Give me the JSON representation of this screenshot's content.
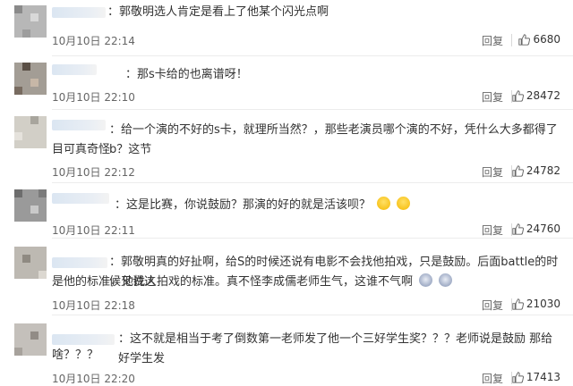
{
  "comments": [
    {
      "text": "郭敬明选人肯定是看上了他某个闪光点啊",
      "time": "10月10日 22:14",
      "reply": "回复",
      "likes": "6680"
    },
    {
      "text": "那s卡给的也离谱呀！",
      "time": "10月10日 22:10",
      "reply": "回复",
      "likes": "28472"
    },
    {
      "text_line1": "给一个演的不好的s卡，就理所当然？，那些老演员哪个演的不好，凭什么大多都得了b？这节",
      "text_line2": "目可真奇怪",
      "time": "10月10日 22:12",
      "reply": "回复",
      "likes": "24782"
    },
    {
      "text": "这是比赛，你说鼓励？那演的好的就是活该呗？",
      "time": "10月10日 22:11",
      "reply": "回复",
      "likes": "24760",
      "emojis": [
        "laughing-tears-emoji",
        "laughing-tears-emoji"
      ]
    },
    {
      "text_line1": "郭敬明真的好扯啊，给S的时候还说有电影不会找他拍戏，只是鼓励。后面battle的时候又说这",
      "text_line2": "是他的标准，他找人拍戏的标准。真不怪李成儒老师生气，这谁不气啊",
      "time": "10月10日 22:18",
      "reply": "回复",
      "likes": "21030",
      "emojis": [
        "angry-face-emoji",
        "angry-face-emoji"
      ]
    },
    {
      "text_line1": "这不就是相当于考了倒数第一老师发了他一个三好学生奖？？？老师说是鼓励 那给好学生发",
      "text_line2": "啥？？？",
      "time": "10月10日 22:20",
      "reply": "回复",
      "likes": "17413"
    }
  ],
  "colors": {
    "accent": "#333333",
    "muted": "#666666",
    "divider": "#ececec"
  },
  "icons": {
    "like": "thumbs-up-icon"
  }
}
